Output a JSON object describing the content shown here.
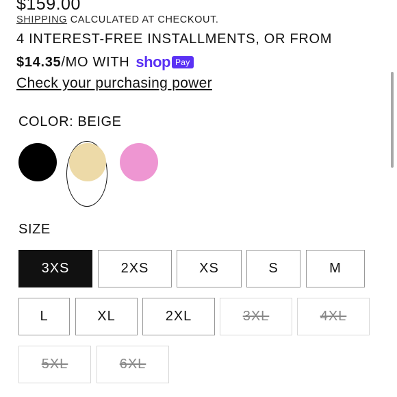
{
  "product": {
    "price": "$159.00"
  },
  "shipping": {
    "link_label": "SHIPPING",
    "suffix": " CALCULATED AT CHECKOUT."
  },
  "installments": {
    "line1": "4 INTEREST-FREE INSTALLMENTS, OR FROM",
    "amount": "$14.35",
    "per_month": "/MO WITH",
    "shop_logo_text": "shop",
    "shop_badge_text": "Pay",
    "check_link": "Check your purchasing power"
  },
  "color": {
    "label": "COLOR: BEIGE",
    "swatches": [
      {
        "name": "black",
        "color": "#000000"
      },
      {
        "name": "beige",
        "color": "#eddaa8",
        "selected": true
      },
      {
        "name": "pink",
        "color": "#ee96d2"
      }
    ]
  },
  "size": {
    "label": "SIZE",
    "options": [
      {
        "label": "3XS",
        "state": "selected"
      },
      {
        "label": "2XS",
        "state": "available"
      },
      {
        "label": "XS",
        "state": "available"
      },
      {
        "label": "S",
        "state": "available"
      },
      {
        "label": "M",
        "state": "available"
      },
      {
        "label": "L",
        "state": "available"
      },
      {
        "label": "XL",
        "state": "available"
      },
      {
        "label": "2XL",
        "state": "available"
      },
      {
        "label": "3XL",
        "state": "unavailable"
      },
      {
        "label": "4XL",
        "state": "unavailable"
      },
      {
        "label": "5XL",
        "state": "unavailable"
      },
      {
        "label": "6XL",
        "state": "unavailable"
      }
    ]
  },
  "colors": {
    "shop_purple": "#5a31f4",
    "selected_size_bg": "#111111"
  }
}
